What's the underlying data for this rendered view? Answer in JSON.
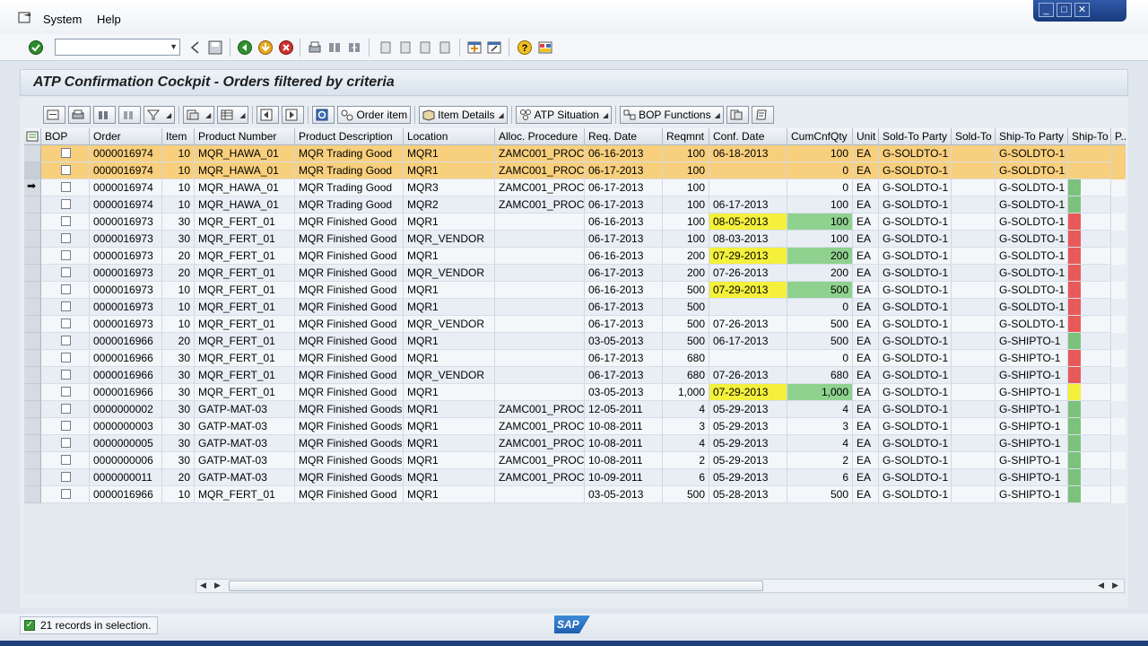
{
  "menubar": {
    "items": [
      "System",
      "Help"
    ]
  },
  "title": "ATP Confirmation Cockpit - Orders filtered by criteria",
  "toolbar": {
    "order_item": "Order item",
    "item_details": "Item Details",
    "atp_situation": "ATP Situation",
    "bop_functions": "BOP Functions"
  },
  "columns": [
    "BOP",
    "Order",
    "Item",
    "Product Number",
    "Product Description",
    "Location",
    "Alloc. Procedure",
    "Req. Date",
    "Reqmnt",
    "Conf. Date",
    "CumCnfQty",
    "Unit",
    "Sold-To Party",
    "Sold-To",
    "Ship-To Party",
    "Ship-To",
    "P.."
  ],
  "rows": [
    {
      "order": "0000016974",
      "item": "10",
      "product": "MQR_HAWA_01",
      "desc": "MQR Trading Good",
      "loc": "MQR1",
      "alloc": "ZAMC001_PROC",
      "req": "06-16-2013",
      "reqmnt": "100",
      "conf": "06-18-2013",
      "cum": "100",
      "unit": "EA",
      "sold": "G-SOLDTO-1",
      "ship": "G-SOLDTO-1",
      "hl": "orange",
      "confc": "",
      "cumc": "",
      "light": ""
    },
    {
      "order": "0000016974",
      "item": "10",
      "product": "MQR_HAWA_01",
      "desc": "MQR Trading Good",
      "loc": "MQR1",
      "alloc": "ZAMC001_PROC",
      "req": "06-17-2013",
      "reqmnt": "100",
      "conf": "",
      "cum": "0",
      "unit": "EA",
      "sold": "G-SOLDTO-1",
      "ship": "G-SOLDTO-1",
      "hl": "orange",
      "confc": "",
      "cumc": "",
      "light": ""
    },
    {
      "order": "0000016974",
      "item": "10",
      "product": "MQR_HAWA_01",
      "desc": "MQR Trading Good",
      "loc": "MQR3",
      "alloc": "ZAMC001_PROC",
      "req": "06-17-2013",
      "reqmnt": "100",
      "conf": "",
      "cum": "0",
      "unit": "EA",
      "sold": "G-SOLDTO-1",
      "ship": "G-SOLDTO-1",
      "hl": "",
      "confc": "",
      "cumc": "",
      "light": "#7cc27c"
    },
    {
      "order": "0000016974",
      "item": "10",
      "product": "MQR_HAWA_01",
      "desc": "MQR Trading Good",
      "loc": "MQR2",
      "alloc": "ZAMC001_PROC",
      "req": "06-17-2013",
      "reqmnt": "100",
      "conf": "06-17-2013",
      "cum": "100",
      "unit": "EA",
      "sold": "G-SOLDTO-1",
      "ship": "G-SOLDTO-1",
      "hl": "",
      "confc": "",
      "cumc": "",
      "light": "#7cc27c"
    },
    {
      "order": "0000016973",
      "item": "30",
      "product": "MQR_FERT_01",
      "desc": "MQR Finished Good",
      "loc": "MQR1",
      "alloc": "",
      "req": "06-16-2013",
      "reqmnt": "100",
      "conf": "08-05-2013",
      "cum": "100",
      "unit": "EA",
      "sold": "G-SOLDTO-1",
      "ship": "G-SOLDTO-1",
      "hl": "",
      "confc": "#f4f03c",
      "cumc": "#8fd18f",
      "light": "#e85a5a"
    },
    {
      "order": "0000016973",
      "item": "30",
      "product": "MQR_FERT_01",
      "desc": "MQR Finished Good",
      "loc": "MQR_VENDOR",
      "alloc": "",
      "req": "06-17-2013",
      "reqmnt": "100",
      "conf": "08-03-2013",
      "cum": "100",
      "unit": "EA",
      "sold": "G-SOLDTO-1",
      "ship": "G-SOLDTO-1",
      "hl": "",
      "confc": "",
      "cumc": "",
      "light": "#e85a5a"
    },
    {
      "order": "0000016973",
      "item": "20",
      "product": "MQR_FERT_01",
      "desc": "MQR Finished Good",
      "loc": "MQR1",
      "alloc": "",
      "req": "06-16-2013",
      "reqmnt": "200",
      "conf": "07-29-2013",
      "cum": "200",
      "unit": "EA",
      "sold": "G-SOLDTO-1",
      "ship": "G-SOLDTO-1",
      "hl": "",
      "confc": "#f4f03c",
      "cumc": "#8fd18f",
      "light": "#e85a5a"
    },
    {
      "order": "0000016973",
      "item": "20",
      "product": "MQR_FERT_01",
      "desc": "MQR Finished Good",
      "loc": "MQR_VENDOR",
      "alloc": "",
      "req": "06-17-2013",
      "reqmnt": "200",
      "conf": "07-26-2013",
      "cum": "200",
      "unit": "EA",
      "sold": "G-SOLDTO-1",
      "ship": "G-SOLDTO-1",
      "hl": "",
      "confc": "",
      "cumc": "",
      "light": "#e85a5a"
    },
    {
      "order": "0000016973",
      "item": "10",
      "product": "MQR_FERT_01",
      "desc": "MQR Finished Good",
      "loc": "MQR1",
      "alloc": "",
      "req": "06-16-2013",
      "reqmnt": "500",
      "conf": "07-29-2013",
      "cum": "500",
      "unit": "EA",
      "sold": "G-SOLDTO-1",
      "ship": "G-SOLDTO-1",
      "hl": "",
      "confc": "#f4f03c",
      "cumc": "#8fd18f",
      "light": "#e85a5a"
    },
    {
      "order": "0000016973",
      "item": "10",
      "product": "MQR_FERT_01",
      "desc": "MQR Finished Good",
      "loc": "MQR1",
      "alloc": "",
      "req": "06-17-2013",
      "reqmnt": "500",
      "conf": "",
      "cum": "0",
      "unit": "EA",
      "sold": "G-SOLDTO-1",
      "ship": "G-SOLDTO-1",
      "hl": "",
      "confc": "",
      "cumc": "",
      "light": "#e85a5a"
    },
    {
      "order": "0000016973",
      "item": "10",
      "product": "MQR_FERT_01",
      "desc": "MQR Finished Good",
      "loc": "MQR_VENDOR",
      "alloc": "",
      "req": "06-17-2013",
      "reqmnt": "500",
      "conf": "07-26-2013",
      "cum": "500",
      "unit": "EA",
      "sold": "G-SOLDTO-1",
      "ship": "G-SOLDTO-1",
      "hl": "",
      "confc": "",
      "cumc": "",
      "light": "#e85a5a"
    },
    {
      "order": "0000016966",
      "item": "20",
      "product": "MQR_FERT_01",
      "desc": "MQR Finished Good",
      "loc": "MQR1",
      "alloc": "",
      "req": "03-05-2013",
      "reqmnt": "500",
      "conf": "06-17-2013",
      "cum": "500",
      "unit": "EA",
      "sold": "G-SOLDTO-1",
      "ship": "G-SHIPTO-1",
      "hl": "",
      "confc": "",
      "cumc": "",
      "light": "#7cc27c"
    },
    {
      "order": "0000016966",
      "item": "30",
      "product": "MQR_FERT_01",
      "desc": "MQR Finished Good",
      "loc": "MQR1",
      "alloc": "",
      "req": "06-17-2013",
      "reqmnt": "680",
      "conf": "",
      "cum": "0",
      "unit": "EA",
      "sold": "G-SOLDTO-1",
      "ship": "G-SHIPTO-1",
      "hl": "",
      "confc": "",
      "cumc": "",
      "light": "#e85a5a"
    },
    {
      "order": "0000016966",
      "item": "30",
      "product": "MQR_FERT_01",
      "desc": "MQR Finished Good",
      "loc": "MQR_VENDOR",
      "alloc": "",
      "req": "06-17-2013",
      "reqmnt": "680",
      "conf": "07-26-2013",
      "cum": "680",
      "unit": "EA",
      "sold": "G-SOLDTO-1",
      "ship": "G-SHIPTO-1",
      "hl": "",
      "confc": "",
      "cumc": "",
      "light": "#e85a5a"
    },
    {
      "order": "0000016966",
      "item": "30",
      "product": "MQR_FERT_01",
      "desc": "MQR Finished Good",
      "loc": "MQR1",
      "alloc": "",
      "req": "03-05-2013",
      "reqmnt": "1,000",
      "conf": "07-29-2013",
      "cum": "1,000",
      "unit": "EA",
      "sold": "G-SOLDTO-1",
      "ship": "G-SHIPTO-1",
      "hl": "",
      "confc": "#f4f03c",
      "cumc": "#8fd18f",
      "light": "#f4f03c"
    },
    {
      "order": "0000000002",
      "item": "30",
      "product": "GATP-MAT-03",
      "desc": "MQR Finished Goods",
      "loc": "MQR1",
      "alloc": "ZAMC001_PROC",
      "req": "12-05-2011",
      "reqmnt": "4",
      "conf": "05-29-2013",
      "cum": "4",
      "unit": "EA",
      "sold": "G-SOLDTO-1",
      "ship": "G-SHIPTO-1",
      "hl": "",
      "confc": "",
      "cumc": "",
      "light": "#7cc27c"
    },
    {
      "order": "0000000003",
      "item": "30",
      "product": "GATP-MAT-03",
      "desc": "MQR Finished Goods",
      "loc": "MQR1",
      "alloc": "ZAMC001_PROC",
      "req": "10-08-2011",
      "reqmnt": "3",
      "conf": "05-29-2013",
      "cum": "3",
      "unit": "EA",
      "sold": "G-SOLDTO-1",
      "ship": "G-SHIPTO-1",
      "hl": "",
      "confc": "",
      "cumc": "",
      "light": "#7cc27c"
    },
    {
      "order": "0000000005",
      "item": "30",
      "product": "GATP-MAT-03",
      "desc": "MQR Finished Goods",
      "loc": "MQR1",
      "alloc": "ZAMC001_PROC",
      "req": "10-08-2011",
      "reqmnt": "4",
      "conf": "05-29-2013",
      "cum": "4",
      "unit": "EA",
      "sold": "G-SOLDTO-1",
      "ship": "G-SHIPTO-1",
      "hl": "",
      "confc": "",
      "cumc": "",
      "light": "#7cc27c"
    },
    {
      "order": "0000000006",
      "item": "30",
      "product": "GATP-MAT-03",
      "desc": "MQR Finished Goods",
      "loc": "MQR1",
      "alloc": "ZAMC001_PROC",
      "req": "10-08-2011",
      "reqmnt": "2",
      "conf": "05-29-2013",
      "cum": "2",
      "unit": "EA",
      "sold": "G-SOLDTO-1",
      "ship": "G-SHIPTO-1",
      "hl": "",
      "confc": "",
      "cumc": "",
      "light": "#7cc27c"
    },
    {
      "order": "0000000011",
      "item": "20",
      "product": "GATP-MAT-03",
      "desc": "MQR Finished Goods",
      "loc": "MQR1",
      "alloc": "ZAMC001_PROC",
      "req": "10-09-2011",
      "reqmnt": "6",
      "conf": "05-29-2013",
      "cum": "6",
      "unit": "EA",
      "sold": "G-SOLDTO-1",
      "ship": "G-SHIPTO-1",
      "hl": "",
      "confc": "",
      "cumc": "",
      "light": "#7cc27c"
    },
    {
      "order": "0000016966",
      "item": "10",
      "product": "MQR_FERT_01",
      "desc": "MQR Finished Good",
      "loc": "MQR1",
      "alloc": "",
      "req": "03-05-2013",
      "reqmnt": "500",
      "conf": "05-28-2013",
      "cum": "500",
      "unit": "EA",
      "sold": "G-SOLDTO-1",
      "ship": "G-SHIPTO-1",
      "hl": "",
      "confc": "",
      "cumc": "",
      "light": "#7cc27c"
    }
  ],
  "status": {
    "text": "21 records in selection."
  },
  "logo": "SAP",
  "colors": {
    "highlight_row": "#f8cf7c",
    "alt_row": "#e8eef4",
    "row": "#f4f7fa"
  }
}
